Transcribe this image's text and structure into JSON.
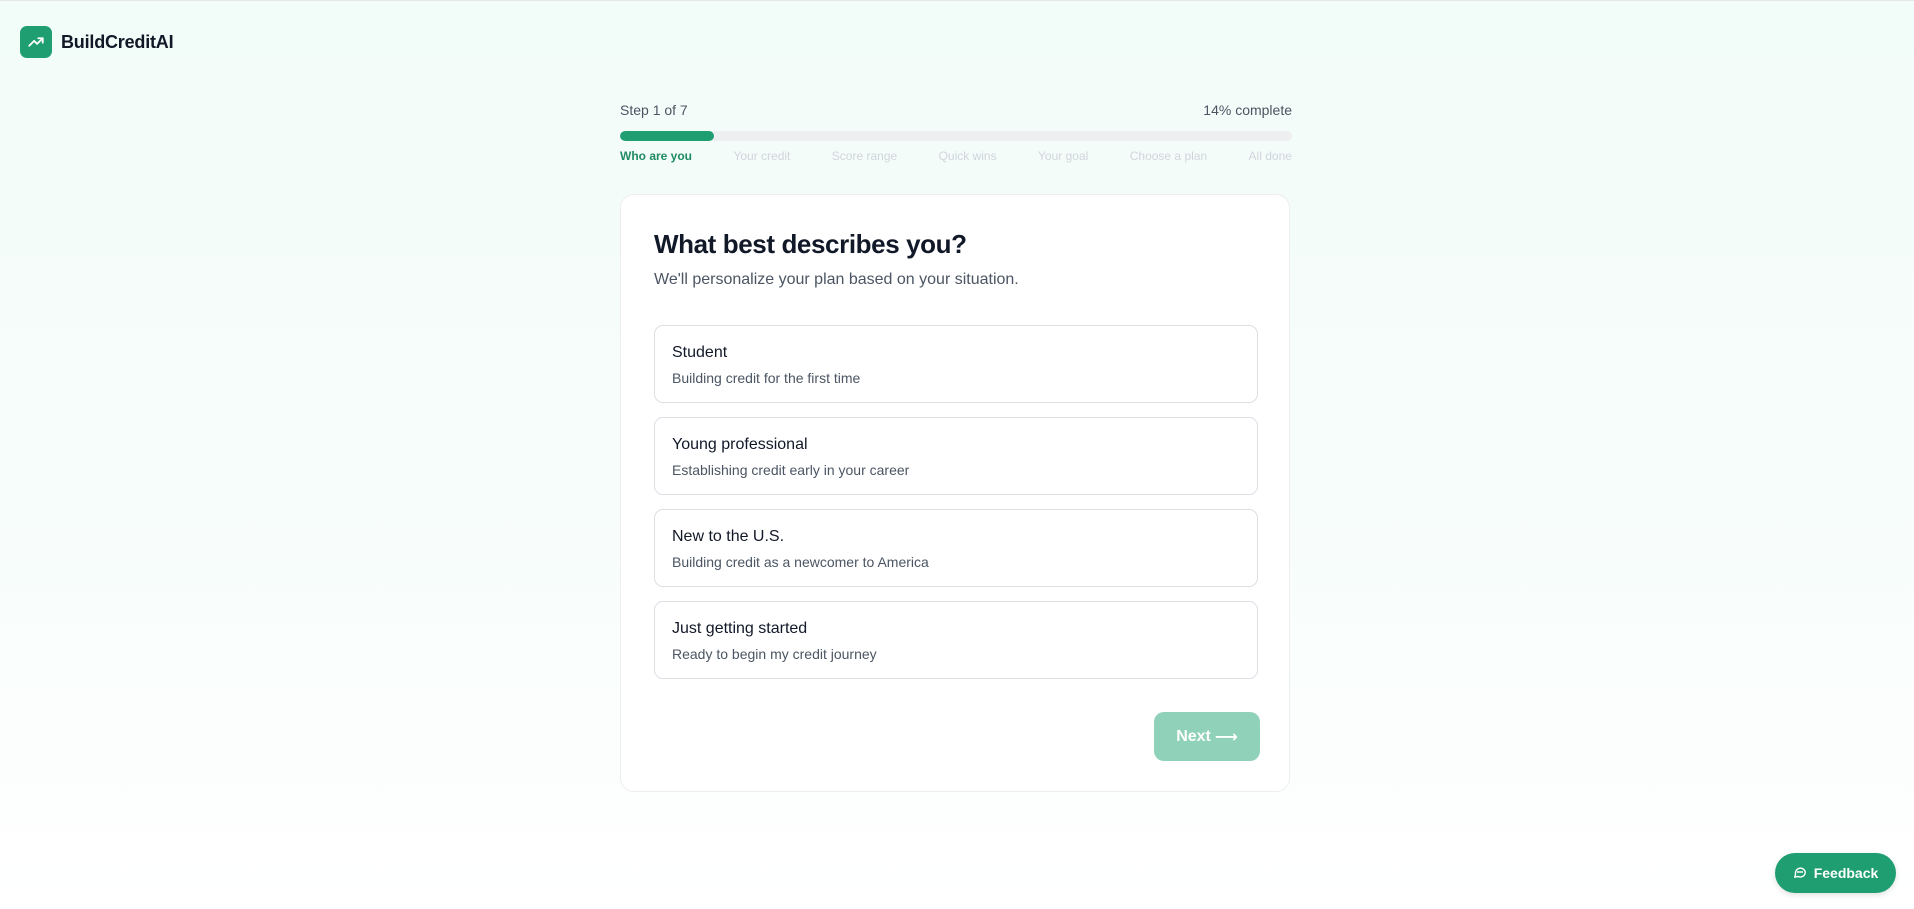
{
  "brand": {
    "name": "BuildCreditAI",
    "icon": "trending-up-icon"
  },
  "progress": {
    "step_label": "Step 1 of 7",
    "complete_label": "14% complete",
    "percent": 14,
    "steps": [
      "Who are you",
      "Your credit",
      "Score range",
      "Quick wins",
      "Your goal",
      "Choose a plan",
      "All done"
    ]
  },
  "card": {
    "title": "What best describes you?",
    "subtitle": "We'll personalize your plan based on your situation.",
    "options": [
      {
        "title": "Student",
        "description": "Building credit for the first time"
      },
      {
        "title": "Young professional",
        "description": "Establishing credit early in your career"
      },
      {
        "title": "New to the U.S.",
        "description": "Building credit as a newcomer to America"
      },
      {
        "title": "Just getting started",
        "description": "Ready to begin my credit journey"
      }
    ],
    "next_label": "Next",
    "next_arrow": "⟶"
  },
  "feedback": {
    "label": "Feedback",
    "icon": "chat-bubble-icon"
  },
  "colors": {
    "accent": "#1f9e72",
    "accent_disabled": "#90d1b9",
    "active_step": "#1f8a64"
  }
}
